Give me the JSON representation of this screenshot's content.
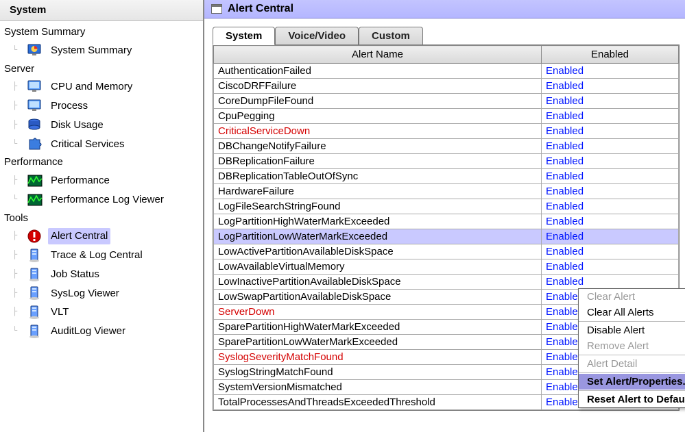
{
  "sidebar": {
    "title": "System",
    "groups": [
      {
        "label": "System Summary",
        "items": [
          {
            "id": "system-summary",
            "label": "System Summary",
            "icon": "monitor-pie"
          }
        ]
      },
      {
        "label": "Server",
        "items": [
          {
            "id": "cpu-memory",
            "label": "CPU and Memory",
            "icon": "monitor"
          },
          {
            "id": "process",
            "label": "Process",
            "icon": "monitor"
          },
          {
            "id": "disk-usage",
            "label": "Disk Usage",
            "icon": "disk"
          },
          {
            "id": "critical-services",
            "label": "Critical Services",
            "icon": "puzzle"
          }
        ]
      },
      {
        "label": "Performance",
        "items": [
          {
            "id": "performance",
            "label": "Performance",
            "icon": "perf"
          },
          {
            "id": "performance-log",
            "label": "Performance Log Viewer",
            "icon": "perf"
          }
        ]
      },
      {
        "label": "Tools",
        "items": [
          {
            "id": "alert-central",
            "label": "Alert Central",
            "icon": "alert",
            "selected": true
          },
          {
            "id": "trace-log",
            "label": "Trace & Log Central",
            "icon": "server"
          },
          {
            "id": "job-status",
            "label": "Job Status",
            "icon": "server"
          },
          {
            "id": "syslog-viewer",
            "label": "SysLog Viewer",
            "icon": "server"
          },
          {
            "id": "vlt",
            "label": "VLT",
            "icon": "server"
          },
          {
            "id": "auditlog-viewer",
            "label": "AuditLog Viewer",
            "icon": "server"
          }
        ]
      }
    ]
  },
  "main": {
    "title": "Alert Central",
    "tabs": [
      {
        "id": "system",
        "label": "System",
        "active": true
      },
      {
        "id": "voice-video",
        "label": "Voice/Video"
      },
      {
        "id": "custom",
        "label": "Custom"
      }
    ],
    "columns": [
      "Alert Name",
      "Enabled"
    ],
    "rows": [
      {
        "name": "AuthenticationFailed",
        "enabled": "Enabled"
      },
      {
        "name": "CiscoDRFFailure",
        "enabled": "Enabled"
      },
      {
        "name": "CoreDumpFileFound",
        "enabled": "Enabled"
      },
      {
        "name": "CpuPegging",
        "enabled": "Enabled"
      },
      {
        "name": "CriticalServiceDown",
        "enabled": "Enabled",
        "red": true
      },
      {
        "name": "DBChangeNotifyFailure",
        "enabled": "Enabled"
      },
      {
        "name": "DBReplicationFailure",
        "enabled": "Enabled"
      },
      {
        "name": "DBReplicationTableOutOfSync",
        "enabled": "Enabled"
      },
      {
        "name": "HardwareFailure",
        "enabled": "Enabled"
      },
      {
        "name": "LogFileSearchStringFound",
        "enabled": "Enabled"
      },
      {
        "name": "LogPartitionHighWaterMarkExceeded",
        "enabled": "Enabled"
      },
      {
        "name": "LogPartitionLowWaterMarkExceeded",
        "enabled": "Enabled",
        "selected": true
      },
      {
        "name": "LowActivePartitionAvailableDiskSpace",
        "enabled": "Enabled"
      },
      {
        "name": "LowAvailableVirtualMemory",
        "enabled": "Enabled"
      },
      {
        "name": "LowInactivePartitionAvailableDiskSpace",
        "enabled": "Enabled"
      },
      {
        "name": "LowSwapPartitionAvailableDiskSpace",
        "enabled": "Enabled"
      },
      {
        "name": "ServerDown",
        "enabled": "Enabled",
        "red": true
      },
      {
        "name": "SparePartitionHighWaterMarkExceeded",
        "enabled": "Enabled"
      },
      {
        "name": "SparePartitionLowWaterMarkExceeded",
        "enabled": "Enabled"
      },
      {
        "name": "SyslogSeverityMatchFound",
        "enabled": "Enabled",
        "red": true
      },
      {
        "name": "SyslogStringMatchFound",
        "enabled": "Enabled"
      },
      {
        "name": "SystemVersionMismatched",
        "enabled": "Enabled"
      },
      {
        "name": "TotalProcessesAndThreadsExceededThreshold",
        "enabled": "Enabled"
      }
    ]
  },
  "context_menu": {
    "items": [
      {
        "label": "Clear Alert",
        "disabled": true
      },
      {
        "label": "Clear All Alerts"
      },
      {
        "sep": true
      },
      {
        "label": "Disable Alert"
      },
      {
        "label": "Remove Alert",
        "disabled": true
      },
      {
        "sep": true
      },
      {
        "label": "Alert Detail",
        "disabled": true
      },
      {
        "sep": true
      },
      {
        "label": "Set Alert/Properties...",
        "highlight": true
      },
      {
        "sep": true
      },
      {
        "label": "Reset Alert to Default Config",
        "bold": true
      }
    ]
  }
}
